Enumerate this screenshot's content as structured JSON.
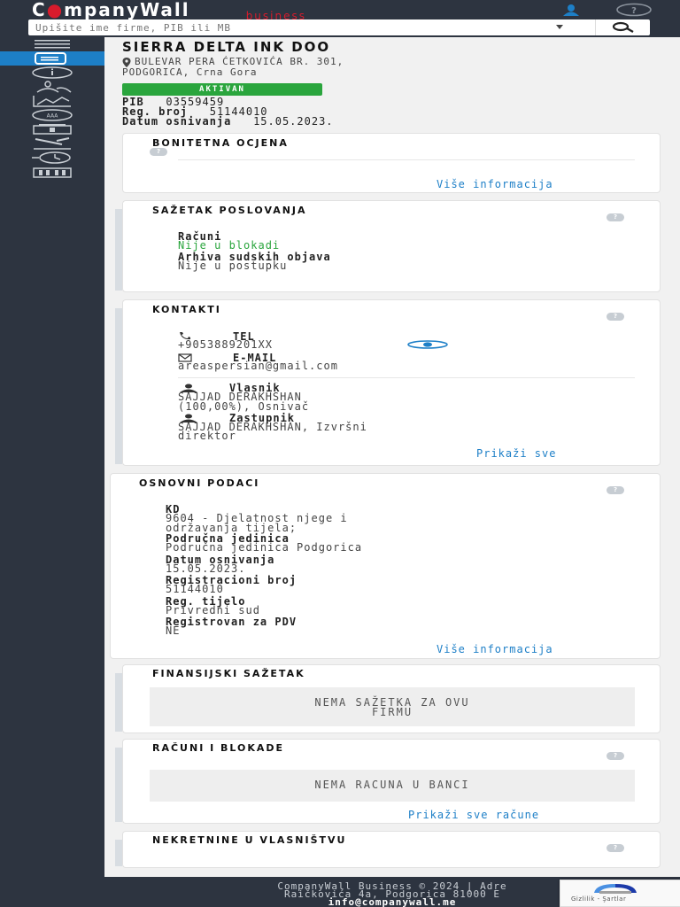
{
  "brand": {
    "name_pre": "C",
    "name_post": "mpanyWall",
    "sub": "business"
  },
  "search": {
    "placeholder": "Upišite ime firme, PIB ili MB"
  },
  "sidebar": {
    "items": [
      {
        "icon": "menu-icon"
      },
      {
        "icon": "document-icon",
        "active": true
      },
      {
        "icon": "info-icon"
      },
      {
        "icon": "people-icon"
      },
      {
        "icon": "chart-icon"
      },
      {
        "icon": "rating-icon"
      },
      {
        "icon": "account-icon"
      },
      {
        "icon": "gavel-icon"
      },
      {
        "icon": "history-icon"
      },
      {
        "icon": "building-icon"
      }
    ]
  },
  "company": {
    "name": "SIERRA DELTA INK DOO",
    "address_line1": "BULEVAR PERA ĆETKOVIĆA BR. 301,",
    "address_line2": "PODGORICA, Crna Gora",
    "status": "AKTIVAN",
    "pib_label": "PIB",
    "pib_value": "03559459",
    "reg_label": "Reg. broj",
    "reg_value": "51144010",
    "date_label": "Datum osnivanja",
    "date_value": "15.05.2023."
  },
  "bonitet": {
    "title": "BONITETNA OCJENA",
    "more": "Više informacija"
  },
  "sazetak": {
    "title": "SAŽETAK POSLOVANJA",
    "racuni_label": "Računi",
    "racuni_value": "Nije u blokadi",
    "arhiva_label": "Arhiva sudskih objava",
    "arhiva_value": "Nije u postupku"
  },
  "kontakti": {
    "title": "KONTAKTI",
    "tel_label": "TEL",
    "tel_value": "+9053889201XX",
    "email_label": "E-MAIL",
    "email_value": "areaspersian@gmail.com",
    "vlasnik_label": "Vlasnik",
    "vlasnik_value1": "SAJJAD DERAKHSHAN",
    "vlasnik_value2": "(100,00%), Osnivač",
    "zastupnik_label": "Zastupnik",
    "zastupnik_value1": "SAJJAD DERAKHSHAN, Izvršni",
    "zastupnik_value2": "direktor",
    "more": "Prikaži sve"
  },
  "osnovni": {
    "title": "OSNOVNI PODACI",
    "kd_label": "KD",
    "kd_value1": "9604 - Djelatnost njege i",
    "kd_value2": "održavanja tijela;",
    "pj_label": "Područna jedinica",
    "pj_value": "Područna jedinica Podgorica",
    "do_label": "Datum osnivanja",
    "do_value": "15.05.2023.",
    "rb_label": "Registracioni broj",
    "rb_value": "51144010",
    "rt_label": "Reg. tijelo",
    "rt_value": "Privredni sud",
    "pdv_label": "Registrovan za PDV",
    "pdv_value": "NE",
    "more": "Više informacija"
  },
  "finansijski": {
    "title": "FINANSIJSKI SAŽETAK",
    "empty1": "NEMA SAŽETKA ZA OVU",
    "empty2": "FIRMU"
  },
  "racuni": {
    "title": "RAČUNI I BLOKADE",
    "empty": "NEMA RACUNA U BANCI",
    "more": "Prikaži sve račune"
  },
  "nekretnine": {
    "title": "NEKRETNINE U VLASNIŠTVU"
  },
  "footer": {
    "line1": "CompanyWall Business © 2024  |  Adre",
    "line2": "Raičkovića 4a, Podgorica 81000    E",
    "email": "info@companywall.me"
  },
  "recaptcha": {
    "text": "Gizlilik - Şartlar"
  },
  "help_glyph": "?",
  "colors": {
    "dark": "#2d3440",
    "accent": "#1d7fc7",
    "active_green": "#2aa53d",
    "brand_red": "#d81b2c"
  }
}
